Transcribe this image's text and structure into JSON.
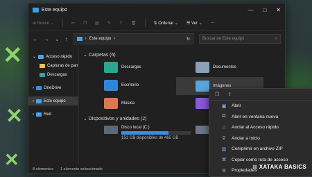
{
  "window": {
    "title": "Este equipo",
    "controls": [
      "—",
      "□",
      "✕"
    ]
  },
  "cmdbar": {
    "new": "Nuevo",
    "sort": "Ordenar",
    "view": "Ver",
    "more": "···"
  },
  "address": {
    "path": "Este equipo",
    "search_placeholder": "Buscar en Este equipo"
  },
  "sidebar": {
    "items": [
      {
        "label": "Acceso rápido"
      },
      {
        "label": "Capturas de pan"
      },
      {
        "label": "Descargas"
      },
      {
        "label": "OneDrive"
      },
      {
        "label": "Este equipo"
      },
      {
        "label": "Red"
      }
    ]
  },
  "sections": {
    "folders_title": "Carpetas (6)",
    "drives_title": "Dispositivos y unidades (2)"
  },
  "folders": [
    "Descargas",
    "Documentos",
    "Escritorio",
    "Imágenes",
    "Música"
  ],
  "drive": {
    "name": "Disco local (C:)",
    "free": "151 GB disponibles de 465 GB",
    "used_fraction": 0.68
  },
  "status": {
    "count": "8 elementos",
    "selected": "1 elemento seleccionado"
  },
  "context_menu": {
    "items": [
      "Abrir",
      "Abrir en ventana nueva",
      "Anclar al Acceso rápido",
      "Anclar a Inicio",
      "Comprimir en archivo ZIP",
      "Copiar como ruta de acceso",
      "Propiedades"
    ]
  },
  "watermark": "XATAKA BASICS"
}
